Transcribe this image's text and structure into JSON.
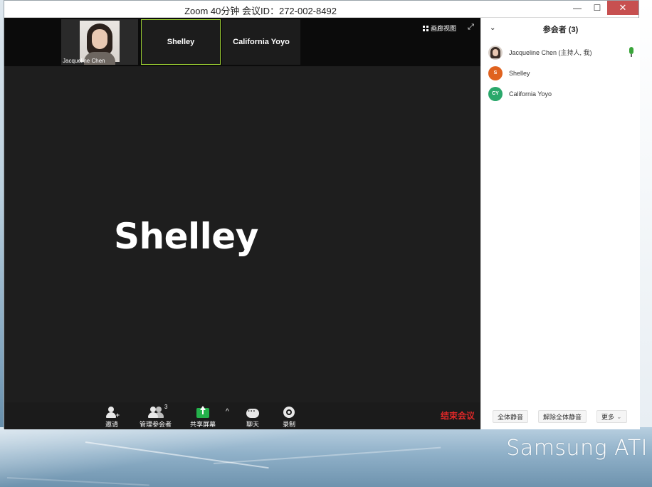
{
  "window": {
    "title": "Zoom 40分钟 会议ID：272-002-8492",
    "minimize": "—",
    "maximize": "☐",
    "close": "✕"
  },
  "video": {
    "thumbnails": [
      {
        "name": "Jacqueline Chen",
        "has_photo": true
      },
      {
        "name": "Shelley",
        "active": true
      },
      {
        "name": "California Yoyo"
      }
    ],
    "gallery_view_label": "画廊视图",
    "active_speaker": "Shelley"
  },
  "toolbar": {
    "invite": "邀请",
    "manage_participants": "管理参会者",
    "participant_count": "3",
    "share_screen": "共享屏幕",
    "chat": "聊天",
    "record": "录制",
    "end_meeting": "结束会议"
  },
  "panel": {
    "title": "参会者 (3)",
    "participants": [
      {
        "name": "Jacqueline Chen (主持人, 我)",
        "avatar": "photo",
        "mic": "on"
      },
      {
        "name": "Shelley",
        "initials": "S",
        "color": "#e0621f"
      },
      {
        "name": "California Yoyo",
        "initials": "CY",
        "color": "#2aa86b"
      }
    ],
    "mute_all": "全体静音",
    "unmute_all": "解除全体静音",
    "more": "更多"
  },
  "desktop": {
    "brand": "Samsung ATI"
  }
}
